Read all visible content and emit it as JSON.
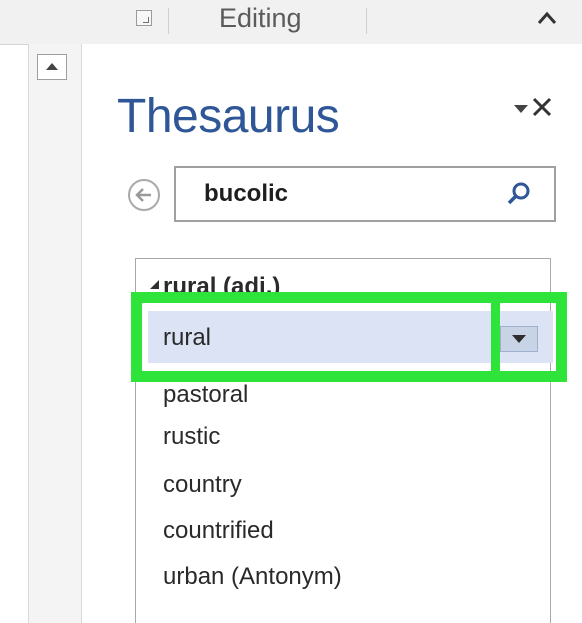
{
  "ribbon": {
    "group_label": "Editing",
    "icons": [
      "dialog-launcher-icon",
      "chevron-up-icon"
    ]
  },
  "pane": {
    "title": "Thesaurus",
    "icons": [
      "options-dropdown-icon",
      "close-icon"
    ]
  },
  "search": {
    "value": "bucolic",
    "icons": [
      "back-arrow-icon",
      "search-icon"
    ]
  },
  "results": {
    "group_label": "rural (adj.)",
    "items": [
      {
        "label": "rural",
        "selected": true
      },
      {
        "label": "pastoral",
        "selected": false
      },
      {
        "label": "rustic",
        "selected": false
      },
      {
        "label": "country",
        "selected": false
      },
      {
        "label": "countrified",
        "selected": false
      },
      {
        "label": "urban (Antonym)",
        "selected": false
      }
    ]
  },
  "colors": {
    "title": "#2f5697",
    "selection": "#dbe3f4",
    "highlight": "#2ee33a"
  }
}
